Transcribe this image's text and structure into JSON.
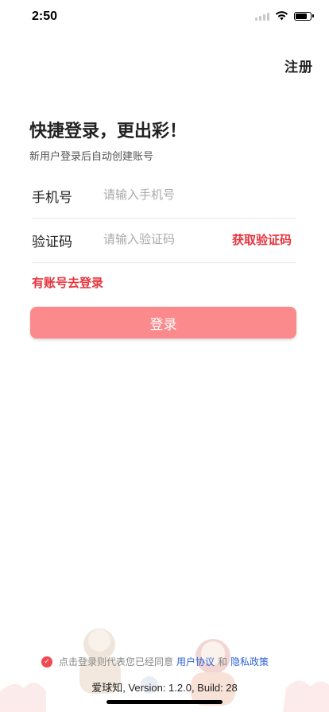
{
  "status_bar": {
    "time": "2:50",
    "battery_level": 0.9
  },
  "header": {
    "register_label": "注册"
  },
  "intro": {
    "title": "快捷登录，更出彩！",
    "subtitle": "新用户登录后自动创建账号"
  },
  "form": {
    "phone_label": "手机号",
    "phone_placeholder": "请输入手机号",
    "phone_value": "",
    "code_label": "验证码",
    "code_placeholder": "请输入验证码",
    "code_value": "",
    "get_code_label": "获取验证码"
  },
  "login_link": "有账号去登录",
  "login_button": "登录",
  "agreement": {
    "checked": true,
    "prefix": "点击登录则代表您已经同意",
    "user_agreement": "用户协议",
    "and": "和",
    "privacy_policy": "隐私政策"
  },
  "footer": {
    "version": "爱球知, Version: 1.2.0, Build: 28"
  },
  "colors": {
    "accent": "#e8343d",
    "button_bg": "#fb8a8c",
    "link_blue": "#2d62d9",
    "check_red": "#f04a50"
  },
  "icons": [
    "signal-icon",
    "wifi-icon",
    "battery-icon",
    "check-circle-icon"
  ]
}
